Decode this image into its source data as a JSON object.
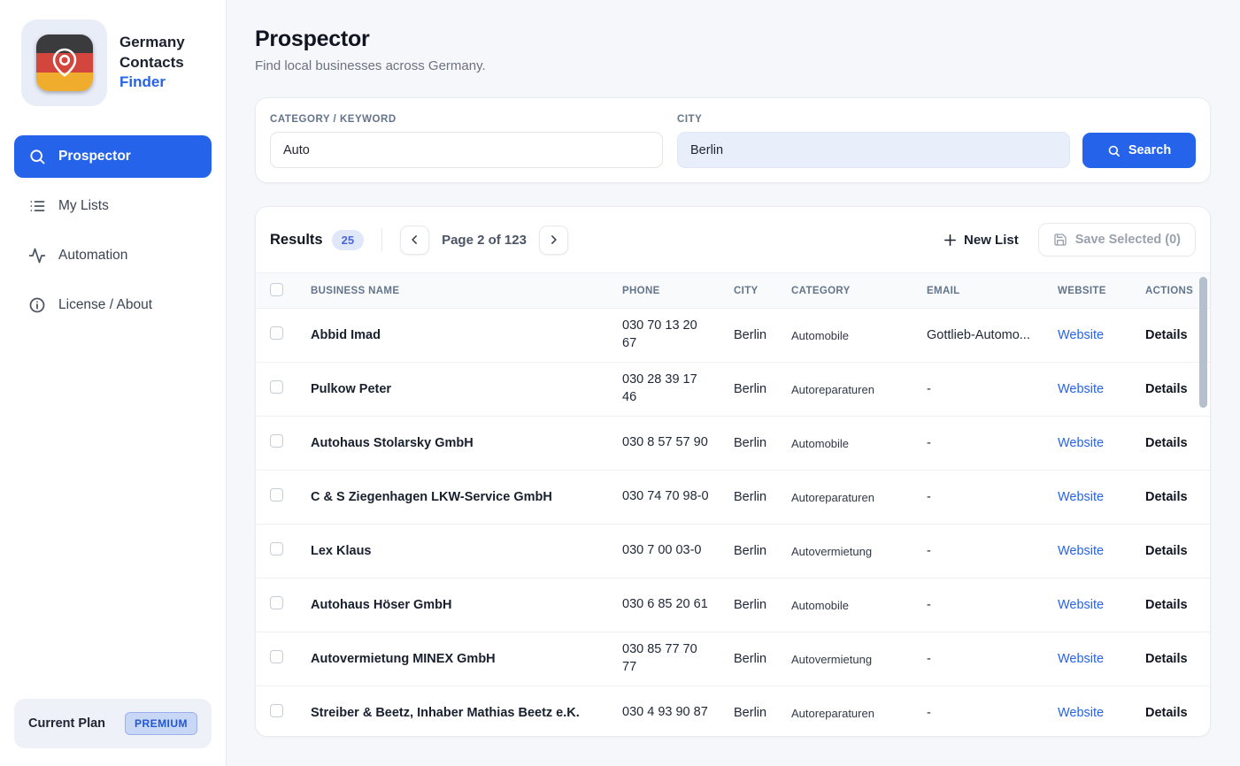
{
  "colors": {
    "accent": "#2563eb",
    "link": "#2563eb",
    "page_bg": "#f6f7fa",
    "badge_bg": "#e0e7f8",
    "badge_text": "#4a68d9",
    "premium_bg": "#c9d7f6",
    "premium_text": "#2157d6",
    "flag_black": "#3b3b3e",
    "flag_red": "#d2463e",
    "flag_gold": "#f0ad2d"
  },
  "sidebar": {
    "brand": {
      "line1": "Germany",
      "line2": "Contacts",
      "line3": "Finder"
    },
    "items": [
      {
        "label": "Prospector",
        "icon": "search-icon",
        "active": true
      },
      {
        "label": "My Lists",
        "icon": "list-icon",
        "active": false
      },
      {
        "label": "Automation",
        "icon": "activity-icon",
        "active": false
      },
      {
        "label": "License / About",
        "icon": "info-icon",
        "active": false
      }
    ],
    "plan": {
      "label": "Current Plan",
      "badge": "PREMIUM"
    }
  },
  "header": {
    "title": "Prospector",
    "subtitle": "Find local businesses across Germany."
  },
  "search": {
    "category_label": "CATEGORY / KEYWORD",
    "category_value": "Auto",
    "city_label": "CITY",
    "city_value": "Berlin",
    "button_label": "Search"
  },
  "results": {
    "title": "Results",
    "count": "25",
    "page_text": "Page 2 of 123",
    "new_list_label": "New List",
    "save_selected_label": "Save Selected (0)"
  },
  "table": {
    "headers": [
      "BUSINESS NAME",
      "PHONE",
      "CITY",
      "CATEGORY",
      "EMAIL",
      "WEBSITE",
      "ACTIONS"
    ],
    "website_label": "Website",
    "details_label": "Details",
    "rows": [
      {
        "name": "Abbid Imad",
        "phone": "030 70 13 20 67",
        "city": "Berlin",
        "category": "Automobile",
        "email": "Gottlieb-Automo..."
      },
      {
        "name": "Pulkow Peter",
        "phone": "030 28 39 17 46",
        "city": "Berlin",
        "category": "Autoreparaturen",
        "email": "-"
      },
      {
        "name": "Autohaus Stolarsky GmbH",
        "phone": "030 8 57 57 90",
        "city": "Berlin",
        "category": "Automobile",
        "email": "-"
      },
      {
        "name": "C & S Ziegenhagen LKW-Service GmbH",
        "phone": "030 74 70 98-0",
        "city": "Berlin",
        "category": "Autoreparaturen",
        "email": "-"
      },
      {
        "name": "Lex Klaus",
        "phone": "030 7 00 03-0",
        "city": "Berlin",
        "category": "Autovermietung",
        "email": "-"
      },
      {
        "name": "Autohaus Höser GmbH",
        "phone": "030 6 85 20 61",
        "city": "Berlin",
        "category": "Automobile",
        "email": "-"
      },
      {
        "name": "Autovermietung MINEX GmbH",
        "phone": "030 85 77 70 77",
        "city": "Berlin",
        "category": "Autovermietung",
        "email": "-"
      },
      {
        "name": "Streiber & Beetz, Inhaber Mathias Beetz e.K.",
        "phone": "030 4 93 90 87",
        "city": "Berlin",
        "category": "Autoreparaturen",
        "email": "-"
      }
    ]
  }
}
